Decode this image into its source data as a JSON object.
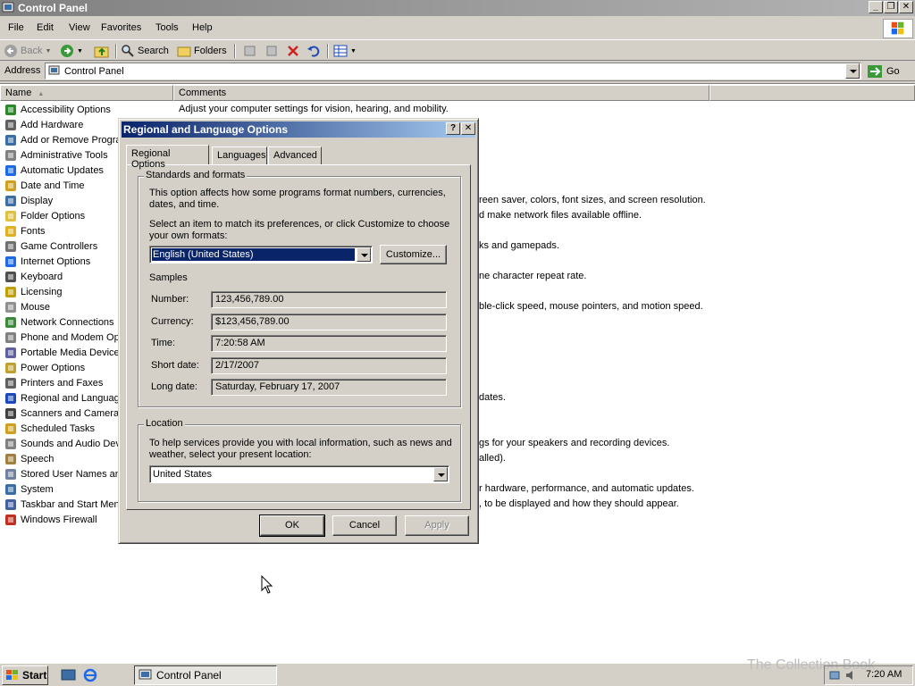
{
  "window": {
    "title": "Control Panel"
  },
  "menu": [
    "File",
    "Edit",
    "View",
    "Favorites",
    "Tools",
    "Help"
  ],
  "toolbar": {
    "back": "Back",
    "search": "Search",
    "folders": "Folders"
  },
  "address": {
    "label": "Address",
    "value": "Control Panel",
    "go": "Go"
  },
  "columns": {
    "name": "Name",
    "comments": "Comments"
  },
  "items": [
    {
      "name": "Accessibility Options",
      "comment": "Adjust your computer settings for vision, hearing, and mobility."
    },
    {
      "name": "Add Hardware",
      "comment": ""
    },
    {
      "name": "Add or Remove Progra",
      "comment": ""
    },
    {
      "name": "Administrative Tools",
      "comment": ""
    },
    {
      "name": "Automatic Updates",
      "comment": ""
    },
    {
      "name": "Date and Time",
      "comment": ""
    },
    {
      "name": "Display",
      "comment": "reen saver, colors, font sizes, and screen resolution."
    },
    {
      "name": "Folder Options",
      "comment": "d make network files available offline."
    },
    {
      "name": "Fonts",
      "comment": ""
    },
    {
      "name": "Game Controllers",
      "comment": "ks and gamepads."
    },
    {
      "name": "Internet Options",
      "comment": ""
    },
    {
      "name": "Keyboard",
      "comment": "ne character repeat rate."
    },
    {
      "name": "Licensing",
      "comment": ""
    },
    {
      "name": "Mouse",
      "comment": "ble-click speed, mouse pointers, and motion speed."
    },
    {
      "name": "Network Connections",
      "comment": ""
    },
    {
      "name": "Phone and Modem Opt",
      "comment": ""
    },
    {
      "name": "Portable Media Devices",
      "comment": ""
    },
    {
      "name": "Power Options",
      "comment": ""
    },
    {
      "name": "Printers and Faxes",
      "comment": ""
    },
    {
      "name": "Regional and Language",
      "comment": "dates."
    },
    {
      "name": "Scanners and Cameras",
      "comment": ""
    },
    {
      "name": "Scheduled Tasks",
      "comment": ""
    },
    {
      "name": "Sounds and Audio Dev",
      "comment": "gs for your speakers and recording devices."
    },
    {
      "name": "Speech",
      "comment": "alled)."
    },
    {
      "name": "Stored User Names and",
      "comment": ""
    },
    {
      "name": "System",
      "comment": "r hardware, performance, and automatic updates."
    },
    {
      "name": "Taskbar and Start Men",
      "comment": ", to be displayed and how they should appear."
    },
    {
      "name": "Windows Firewall",
      "comment": ""
    }
  ],
  "dialog": {
    "title": "Regional and Language Options",
    "help_btn": "?",
    "close_btn": "✕",
    "tabs": [
      "Regional Options",
      "Languages",
      "Advanced"
    ],
    "standards_group": "Standards and formats",
    "standards_desc": "This option affects how some programs format numbers, currencies, dates, and time.",
    "select_desc": "Select an item to match its preferences, or click Customize to choose your own formats:",
    "format_value": "English (United States)",
    "customize": "Customize...",
    "samples_label": "Samples",
    "samples": [
      {
        "label": "Number:",
        "value": "123,456,789.00"
      },
      {
        "label": "Currency:",
        "value": "$123,456,789.00"
      },
      {
        "label": "Time:",
        "value": "7:20:58 AM"
      },
      {
        "label": "Short date:",
        "value": "2/17/2007"
      },
      {
        "label": "Long date:",
        "value": "Saturday, February 17, 2007"
      }
    ],
    "location_group": "Location",
    "location_desc": "To help services provide you with local information, such as news and weather, select your present location:",
    "location_value": "United States",
    "ok": "OK",
    "cancel": "Cancel",
    "apply": "Apply"
  },
  "taskbar": {
    "start": "Start",
    "task": "Control Panel",
    "clock": "7:20 AM",
    "watermark": "The Collection Book"
  }
}
